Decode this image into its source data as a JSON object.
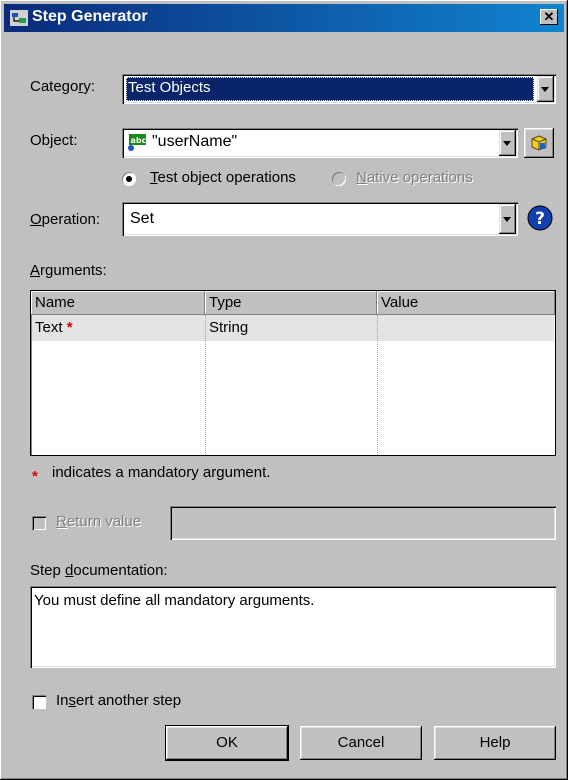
{
  "window": {
    "title": "Step Generator",
    "close_glyph": "✕"
  },
  "category": {
    "label": "Category:",
    "value": "Test Objects"
  },
  "object": {
    "label": "Object:",
    "value": "\"userName\"",
    "icon": "web-edit-object-icon"
  },
  "operation_type": {
    "test_ops_label": "Test object operations",
    "native_ops_label": "Native operations",
    "selected": "test"
  },
  "operation": {
    "label": "Operation:",
    "value": "Set"
  },
  "arguments": {
    "label": "Arguments:",
    "columns": [
      "Name",
      "Type",
      "Value"
    ],
    "rows": [
      {
        "name": "Text",
        "mandatory": "*",
        "type": "String",
        "value": ""
      }
    ],
    "mandatory_note_star": "*",
    "mandatory_note": "indicates a mandatory argument."
  },
  "return_value": {
    "label": "Return value",
    "value": "",
    "checked": false,
    "enabled": false
  },
  "documentation": {
    "label": "Step documentation:",
    "text": "You must define all mandatory arguments."
  },
  "insert_another": {
    "label": "Insert another step",
    "checked": false
  },
  "buttons": {
    "ok": "OK",
    "cancel": "Cancel",
    "help": "Help"
  },
  "colors": {
    "title_start": "#0a2a7a",
    "title_end": "#1084d0",
    "selection": "#0a246a",
    "mandatory_star": "#e00000"
  }
}
